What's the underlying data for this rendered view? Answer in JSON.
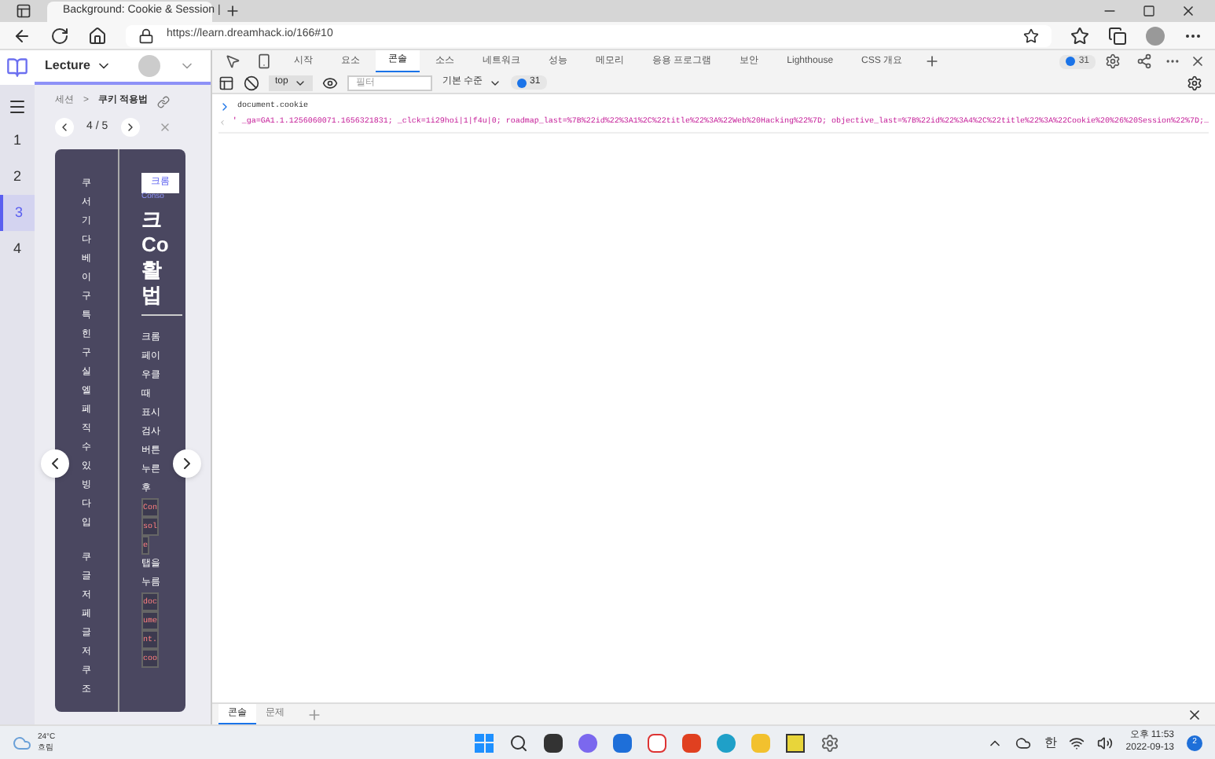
{
  "browser": {
    "tab_title": "Background: Cookie & Session |",
    "url": "https://learn.dreamhack.io/166#10"
  },
  "lecture": {
    "menu": "Lecture",
    "nav": [
      {
        "label": "1",
        "selected": false
      },
      {
        "label": "2",
        "selected": false
      },
      {
        "label": "3",
        "selected": true
      },
      {
        "label": "4",
        "selected": false
      }
    ],
    "breadcrumb": [
      "세션",
      ">",
      "쿠키 적용법"
    ],
    "pager": "4 / 5",
    "vertical_texts": [
      "쿠서기다베이구특힌구실엘페직수있빙다입",
      "쿠글저페글저쿠조"
    ],
    "slide_tab": "크롬",
    "slide_tab_sub": "Conso",
    "slide_heading": [
      "크",
      "Co",
      "활",
      "법"
    ],
    "slide_lines": [
      {
        "text": "크롬",
        "kind": "text"
      },
      {
        "text": "페이",
        "kind": "text"
      },
      {
        "text": "우클",
        "kind": "text"
      },
      {
        "text": "때",
        "kind": "text"
      },
      {
        "text": "표시",
        "kind": "text"
      },
      {
        "text": "검사",
        "kind": "text"
      },
      {
        "text": "버튼",
        "kind": "text"
      },
      {
        "text": "누른",
        "kind": "text"
      },
      {
        "text": "후",
        "kind": "text"
      },
      {
        "text": "Con",
        "kind": "code"
      },
      {
        "text": "sol",
        "kind": "code"
      },
      {
        "text": "e",
        "kind": "code"
      },
      {
        "text": "탭을",
        "kind": "text"
      },
      {
        "text": "누름",
        "kind": "text"
      },
      {
        "text": "doc",
        "kind": "code"
      },
      {
        "text": "ume",
        "kind": "code"
      },
      {
        "text": "nt.",
        "kind": "code"
      },
      {
        "text": "coo",
        "kind": "code"
      }
    ]
  },
  "devtools": {
    "tabs": [
      {
        "label": "시작",
        "selected": false
      },
      {
        "label": "요소",
        "selected": false
      },
      {
        "label": "콘솔",
        "selected": true
      },
      {
        "label": "소스",
        "selected": false
      },
      {
        "label": "네트워크",
        "selected": false
      },
      {
        "label": "성능",
        "selected": false
      },
      {
        "label": "메모리",
        "selected": false
      },
      {
        "label": "응용 프로그램",
        "selected": false
      },
      {
        "label": "보안",
        "selected": false
      },
      {
        "label": "Lighthouse",
        "selected": false
      },
      {
        "label": "CSS 개요",
        "selected": false
      }
    ],
    "issues_count": "31",
    "context": "top",
    "filter_placeholder": "필터",
    "level": "기본 수준",
    "console_count": "31",
    "input": "document.cookie",
    "output": "' _ga=GA1.1.1256060071.1656321831; _clck=1i29hoi|1|f4u|0; roadmap_last=%7B%22id%22%3A1%2C%22title%22%3A%22Web%20Hacking%22%7D; objective_last=%7B%22id%22%3A4%2C%22title%22%3A%22Cookie%20%26%20Session%22%7D;…",
    "drawer_tabs": [
      {
        "label": "콘솔",
        "selected": true
      },
      {
        "label": "문제",
        "selected": false
      }
    ]
  },
  "taskbar": {
    "temperature": "24°C",
    "weather": "흐림",
    "ime": "한",
    "time": "오후 11:53",
    "date": "2022-09-13",
    "notifications": "2"
  }
}
